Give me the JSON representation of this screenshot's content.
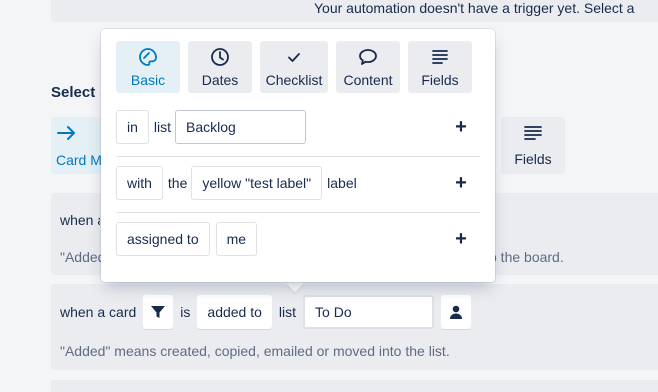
{
  "background": {
    "top_notice": "Your automation doesn't have a trigger yet. Select a",
    "select_title": "Select a trigger",
    "tabs": [
      {
        "label": "Card Move",
        "icon": "arrow-right-icon"
      },
      {
        "label": "Fields",
        "icon": "fields-icon"
      }
    ],
    "trigger1": {
      "line": "when a",
      "note_start": "\"Added",
      "note_end": "o the board."
    },
    "trigger2": {
      "when": "when a card",
      "is": "is",
      "action": "added to",
      "list_label": "list",
      "list_value": "To Do",
      "note": "\"Added\" means created, copied, emailed or moved into the list."
    }
  },
  "popover": {
    "tabs": [
      {
        "label": "Basic",
        "icon": "palette-icon",
        "active": true
      },
      {
        "label": "Dates",
        "icon": "clock-icon",
        "active": false
      },
      {
        "label": "Checklist",
        "icon": "check-icon",
        "active": false
      },
      {
        "label": "Content",
        "icon": "speech-bubble-icon",
        "active": false
      },
      {
        "label": "Fields",
        "icon": "fields-icon",
        "active": false
      }
    ],
    "rows": [
      {
        "btn": "in",
        "label": "list",
        "field": "Backlog"
      },
      {
        "btn": "with",
        "label": "the",
        "field": "yellow \"test label\"",
        "suffix": "label"
      },
      {
        "btn": "assigned to",
        "field": "me"
      }
    ],
    "plus": "+"
  },
  "colors": {
    "accent": "#0079bf",
    "active_tab_bg": "#e4f0f6",
    "tab_bg": "#ebecf0",
    "text": "#172b4d"
  }
}
